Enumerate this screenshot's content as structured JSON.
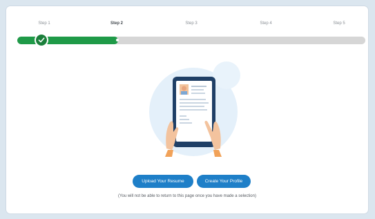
{
  "steps": {
    "items": [
      {
        "label": "Step 1",
        "state": "complete"
      },
      {
        "label": "Step 2",
        "state": "current"
      },
      {
        "label": "Step 3",
        "state": "upcoming"
      },
      {
        "label": "Step 4",
        "state": "upcoming"
      },
      {
        "label": "Step 5",
        "state": "upcoming"
      }
    ],
    "progress_fraction": 0.29
  },
  "colors": {
    "progress": "#1f9a48",
    "check": "#1b7f3b",
    "button": "#1e7fc8",
    "track": "#d6d6d6"
  },
  "actions": {
    "upload_resume_label": "Upload Your Resume",
    "create_profile_label": "Create Your Profile"
  },
  "notice_text": "(You will not be able to return to this page once you have made a selection)",
  "icons": [
    "check-icon",
    "tablet-resume-illustration"
  ]
}
